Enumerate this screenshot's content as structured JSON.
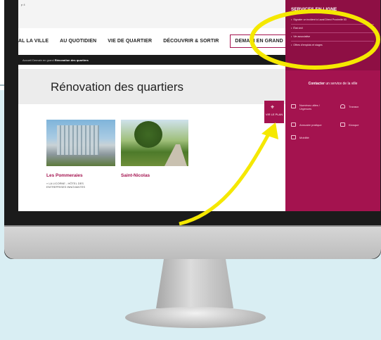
{
  "screen": {
    "page_indicator": "p 4",
    "nav": [
      "AL LA VILLE",
      "AU QUOTIDIEN",
      "VIE DE QUARTIER",
      "DÉCOUVRIR & SORTIR",
      "DEMAIN EN GRAND"
    ],
    "breadcrumb": {
      "items": "Accueil   Demain en grand   ",
      "current": "Rénovation des quartiers"
    },
    "page_title": "Rénovation des quartiers",
    "cards": [
      {
        "title": "Les Pommeraies",
        "subtitle": "» LA LICORNE - HÔTEL DES ENTREPRISES INNOVANTES"
      },
      {
        "title": "Saint-Nicolas"
      }
    ],
    "pin_label": "VIR LE PLAN"
  },
  "sidebar": {
    "title": "SERVICES EN LIGNE",
    "links": [
      "Signaler un incident à Laval Direct Proximité 53",
      "État civil",
      "Vie associative",
      "Offres d'emplois et stages"
    ],
    "contact_bold": "Contacter",
    "contact_rest": " un service de la ville",
    "grid": [
      "Numéros utiles / Urgences",
      "Travaux",
      "Annuaire pratique",
      "Kiosque",
      "Mobilité"
    ]
  },
  "colors": {
    "brand": "#a4134f",
    "highlight": "#f5e800",
    "backdrop": "#d9eef3"
  }
}
